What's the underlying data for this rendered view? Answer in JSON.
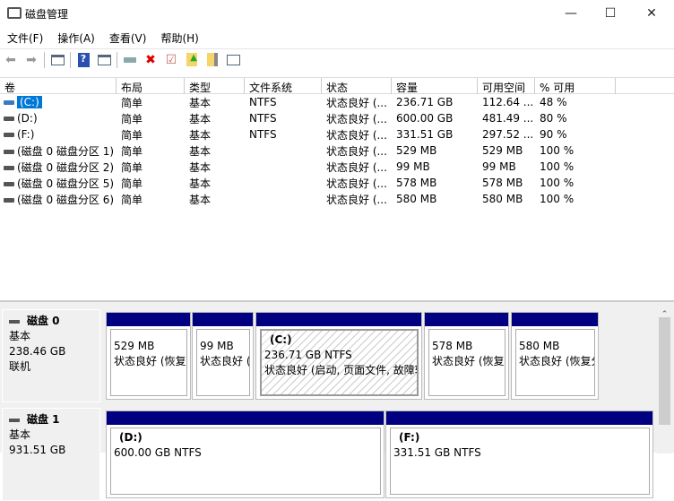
{
  "window": {
    "title": "磁盘管理",
    "min": "—",
    "max": "☐",
    "close": "✕"
  },
  "menu": [
    "文件(F)",
    "操作(A)",
    "查看(V)",
    "帮助(H)"
  ],
  "columns": [
    "卷",
    "布局",
    "类型",
    "文件系统",
    "状态",
    "容量",
    "可用空间",
    "% 可用"
  ],
  "volumes": [
    [
      "(C:)",
      "简单",
      "基本",
      "NTFS",
      "状态良好 (...",
      "236.71 GB",
      "112.64 ...",
      "48 %"
    ],
    [
      "(D:)",
      "简单",
      "基本",
      "NTFS",
      "状态良好 (...",
      "600.00 GB",
      "481.49 ...",
      "80 %"
    ],
    [
      "(F:)",
      "简单",
      "基本",
      "NTFS",
      "状态良好 (...",
      "331.51 GB",
      "297.52 ...",
      "90 %"
    ],
    [
      "(磁盘 0 磁盘分区 1)",
      "简单",
      "基本",
      "",
      "状态良好 (...",
      "529 MB",
      "529 MB",
      "100 %"
    ],
    [
      "(磁盘 0 磁盘分区 2)",
      "简单",
      "基本",
      "",
      "状态良好 (...",
      "99 MB",
      "99 MB",
      "100 %"
    ],
    [
      "(磁盘 0 磁盘分区 5)",
      "简单",
      "基本",
      "",
      "状态良好 (...",
      "578 MB",
      "578 MB",
      "100 %"
    ],
    [
      "(磁盘 0 磁盘分区 6)",
      "简单",
      "基本",
      "",
      "状态良好 (...",
      "580 MB",
      "580 MB",
      "100 %"
    ]
  ],
  "disks": [
    {
      "name": "磁盘 0",
      "type": "基本",
      "size": "238.46 GB",
      "status": "联机",
      "partitions": [
        {
          "label": "",
          "size": "529 MB",
          "status": "状态良好 (恢复"
        },
        {
          "label": "",
          "size": "99 MB",
          "status": "状态良好 (EFI"
        },
        {
          "label": "(C:)",
          "size": "236.71 GB NTFS",
          "status": "状态良好 (启动, 页面文件, 故障转"
        },
        {
          "label": "",
          "size": "578 MB",
          "status": "状态良好 (恢复"
        },
        {
          "label": "",
          "size": "580 MB",
          "status": "状态良好 (恢复分"
        }
      ]
    },
    {
      "name": "磁盘 1",
      "type": "基本",
      "size": "931.51 GB",
      "status": "",
      "partitions": [
        {
          "label": "(D:)",
          "size": "600.00 GB NTFS",
          "status": ""
        },
        {
          "label": "(F:)",
          "size": "331.51 GB NTFS",
          "status": ""
        }
      ]
    }
  ],
  "colors": {
    "partition_header": "#000080",
    "selection": "#0078d7"
  }
}
